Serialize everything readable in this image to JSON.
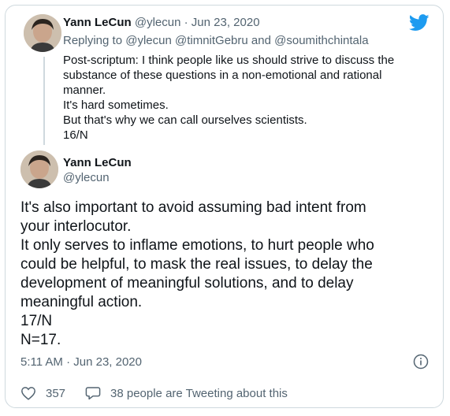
{
  "tweet1": {
    "name": "Yann LeCun",
    "handle": "@ylecun",
    "separator": "·",
    "date": "Jun 23, 2020",
    "replying_prefix": "Replying to",
    "mention1": "@ylecun",
    "mention2": "@timnitGebru",
    "and_word": "and",
    "mention3": "@soumithchintala",
    "lines": [
      "Post-scriptum: I think people like us should strive to discuss the",
      "substance of these questions in a non-emotional and rational",
      "manner.",
      "It's hard sometimes.",
      "But that's why we can call ourselves scientists.",
      "16/N"
    ]
  },
  "tweet2": {
    "name": "Yann LeCun",
    "handle": "@ylecun",
    "lines": [
      "It's also important to avoid assuming bad intent from",
      "your interlocutor.",
      "It only serves to inflame emotions, to hurt people who",
      "could  be helpful, to mask the real issues, to delay the",
      "development of meaningful solutions, and to delay",
      "meaningful action.",
      "17/N",
      "N=17."
    ],
    "timestamp": "5:11 AM · Jun 23, 2020",
    "likes": "357",
    "replies_text": "38 people are Tweeting about this"
  },
  "icons": {
    "logo": "twitter-bird-icon",
    "info": "info-icon",
    "like": "heart-icon",
    "reply": "speech-bubble-icon"
  },
  "colors": {
    "brand": "#1d9bf0",
    "text": "#0f1419",
    "muted": "#536471",
    "border": "#cfd9de"
  }
}
